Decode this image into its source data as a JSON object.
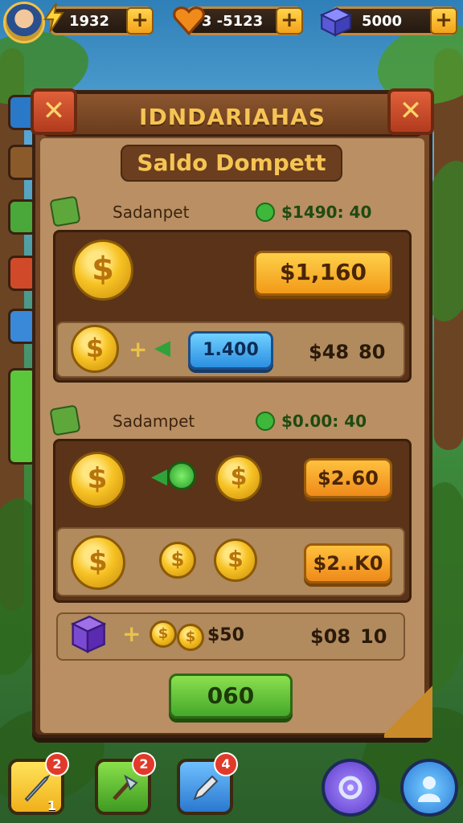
{
  "topbar": {
    "coins": "1932",
    "hearts": "3 -5123",
    "gems": "5000",
    "plus": "+"
  },
  "panel": {
    "title": "IDNDARIAHAS",
    "subtitle": "Saldo Dompett",
    "close": "✕"
  },
  "section1": {
    "label": "Sadanpet",
    "balance": "$1490: 40",
    "main_button": "$1,160",
    "exchange_button": "1.400",
    "price": "$48",
    "amount": "80"
  },
  "section2": {
    "label": "Sadampet",
    "balance": "$0.00: 40",
    "button_one": "$2.60",
    "button_two": "$2..K0",
    "item_amount": "$50",
    "price": "$08",
    "amount": "10"
  },
  "confirm_button": "060",
  "bottom_bar": {
    "slots": [
      {
        "badge": "2",
        "count": "1"
      },
      {
        "badge": "2",
        "count": ""
      },
      {
        "badge": "4",
        "count": ""
      }
    ]
  },
  "icons": {
    "coin": "$",
    "green_arrow": "◀"
  },
  "colors": {
    "title": "#f6c453",
    "panel": "#7a4a28",
    "gold_button": "#f29a18",
    "blue_button": "#2c8fe0",
    "green_button": "#45a82a"
  }
}
